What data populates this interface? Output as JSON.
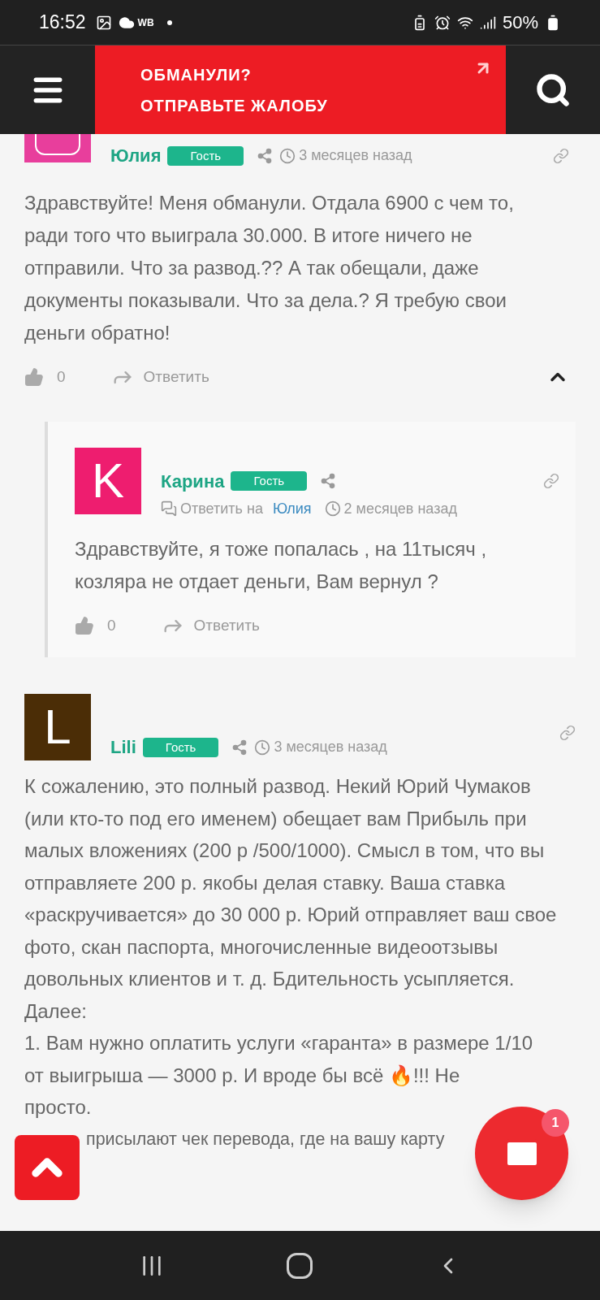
{
  "status_bar": {
    "time": "16:52",
    "carrier_label": "WB",
    "battery": "50%"
  },
  "header": {
    "banner_lines": [
      "ОБМАНУЛИ?",
      "ОТПРАВЬТЕ ЖАЛОБУ"
    ]
  },
  "comments": [
    {
      "author": "Юлия",
      "badge": "Гость",
      "time": "3 месяцев назад",
      "color": "#e83e9c",
      "text": "Здравствуйте! Меня обманули. Отдала 6900 с чем то, ради того что выиграла 30.000. В итоге ничего не отправили. Что за развод.?? А так обещали, даже документы показывали. Что за дела.? Я требую свои деньги обратно!",
      "likes": "0",
      "reply": "Ответить",
      "expanded": true,
      "children": [
        {
          "author": "Карина",
          "badge": "Гость",
          "avatar_letter": "K",
          "color": "#ee1d6f",
          "reply_label": "Ответить на",
          "reply_to": "Юлия",
          "time": "2 месяцев назад",
          "text": "Здравствуйте, я тоже попалась , на 11тысяч , козляра не отдает деньги, Вам вернул ?",
          "likes": "0",
          "reply": "Ответить"
        }
      ]
    },
    {
      "author": "Lili",
      "badge": "Гость",
      "avatar_letter": "L",
      "color": "#4b2d06",
      "time": "3 месяцев назад",
      "text": "К сожалению, это полный развод. Некий Юрий Чумаков (или кто-то под его именем) обещает вам Прибыль при малых вложениях (200 р /500/1000). Смысл в том, что вы отправляете 200 р. якобы делая ставку. Ваша ставка «раскручивается» до 30 000 р. Юрий отправляет ваш свое фото, скан паспорта, многочисленные видеоотзывы довольных клиентов и т. д. Бдительность усыпляется.",
      "lines": [
        "Далее:",
        "1. Вам нужно оплатить услуги «гаранта» в размере 1/10",
        "от выигрыша — 3000 р. И вроде бы всё 🔥!!! Не",
        "просто.",
        "присылают чек перевода, где на вашу карту"
      ]
    }
  ],
  "messages_fab": {
    "badge": "1"
  }
}
